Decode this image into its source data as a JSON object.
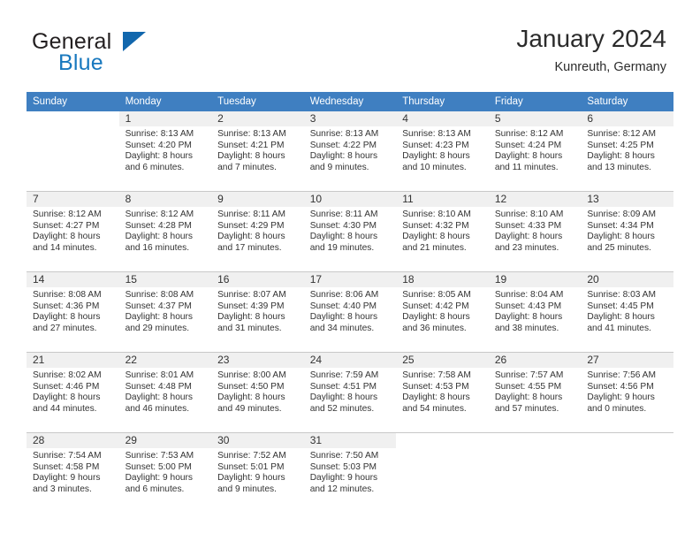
{
  "brand": {
    "name_top": "General",
    "name_bottom": "Blue",
    "mark": "triangle-logo"
  },
  "header": {
    "title": "January 2024",
    "location": "Kunreuth, Germany"
  },
  "calendar": {
    "weekday_headers": [
      "Sunday",
      "Monday",
      "Tuesday",
      "Wednesday",
      "Thursday",
      "Friday",
      "Saturday"
    ],
    "accent_color": "#3f7fc1",
    "daynum_bg": "#f0f0f0",
    "weeks": [
      [
        {
          "day": "",
          "sunrise": "",
          "sunset": "",
          "daylight1": "",
          "daylight2": ""
        },
        {
          "day": "1",
          "sunrise": "Sunrise: 8:13 AM",
          "sunset": "Sunset: 4:20 PM",
          "daylight1": "Daylight: 8 hours",
          "daylight2": "and 6 minutes."
        },
        {
          "day": "2",
          "sunrise": "Sunrise: 8:13 AM",
          "sunset": "Sunset: 4:21 PM",
          "daylight1": "Daylight: 8 hours",
          "daylight2": "and 7 minutes."
        },
        {
          "day": "3",
          "sunrise": "Sunrise: 8:13 AM",
          "sunset": "Sunset: 4:22 PM",
          "daylight1": "Daylight: 8 hours",
          "daylight2": "and 9 minutes."
        },
        {
          "day": "4",
          "sunrise": "Sunrise: 8:13 AM",
          "sunset": "Sunset: 4:23 PM",
          "daylight1": "Daylight: 8 hours",
          "daylight2": "and 10 minutes."
        },
        {
          "day": "5",
          "sunrise": "Sunrise: 8:12 AM",
          "sunset": "Sunset: 4:24 PM",
          "daylight1": "Daylight: 8 hours",
          "daylight2": "and 11 minutes."
        },
        {
          "day": "6",
          "sunrise": "Sunrise: 8:12 AM",
          "sunset": "Sunset: 4:25 PM",
          "daylight1": "Daylight: 8 hours",
          "daylight2": "and 13 minutes."
        }
      ],
      [
        {
          "day": "7",
          "sunrise": "Sunrise: 8:12 AM",
          "sunset": "Sunset: 4:27 PM",
          "daylight1": "Daylight: 8 hours",
          "daylight2": "and 14 minutes."
        },
        {
          "day": "8",
          "sunrise": "Sunrise: 8:12 AM",
          "sunset": "Sunset: 4:28 PM",
          "daylight1": "Daylight: 8 hours",
          "daylight2": "and 16 minutes."
        },
        {
          "day": "9",
          "sunrise": "Sunrise: 8:11 AM",
          "sunset": "Sunset: 4:29 PM",
          "daylight1": "Daylight: 8 hours",
          "daylight2": "and 17 minutes."
        },
        {
          "day": "10",
          "sunrise": "Sunrise: 8:11 AM",
          "sunset": "Sunset: 4:30 PM",
          "daylight1": "Daylight: 8 hours",
          "daylight2": "and 19 minutes."
        },
        {
          "day": "11",
          "sunrise": "Sunrise: 8:10 AM",
          "sunset": "Sunset: 4:32 PM",
          "daylight1": "Daylight: 8 hours",
          "daylight2": "and 21 minutes."
        },
        {
          "day": "12",
          "sunrise": "Sunrise: 8:10 AM",
          "sunset": "Sunset: 4:33 PM",
          "daylight1": "Daylight: 8 hours",
          "daylight2": "and 23 minutes."
        },
        {
          "day": "13",
          "sunrise": "Sunrise: 8:09 AM",
          "sunset": "Sunset: 4:34 PM",
          "daylight1": "Daylight: 8 hours",
          "daylight2": "and 25 minutes."
        }
      ],
      [
        {
          "day": "14",
          "sunrise": "Sunrise: 8:08 AM",
          "sunset": "Sunset: 4:36 PM",
          "daylight1": "Daylight: 8 hours",
          "daylight2": "and 27 minutes."
        },
        {
          "day": "15",
          "sunrise": "Sunrise: 8:08 AM",
          "sunset": "Sunset: 4:37 PM",
          "daylight1": "Daylight: 8 hours",
          "daylight2": "and 29 minutes."
        },
        {
          "day": "16",
          "sunrise": "Sunrise: 8:07 AM",
          "sunset": "Sunset: 4:39 PM",
          "daylight1": "Daylight: 8 hours",
          "daylight2": "and 31 minutes."
        },
        {
          "day": "17",
          "sunrise": "Sunrise: 8:06 AM",
          "sunset": "Sunset: 4:40 PM",
          "daylight1": "Daylight: 8 hours",
          "daylight2": "and 34 minutes."
        },
        {
          "day": "18",
          "sunrise": "Sunrise: 8:05 AM",
          "sunset": "Sunset: 4:42 PM",
          "daylight1": "Daylight: 8 hours",
          "daylight2": "and 36 minutes."
        },
        {
          "day": "19",
          "sunrise": "Sunrise: 8:04 AM",
          "sunset": "Sunset: 4:43 PM",
          "daylight1": "Daylight: 8 hours",
          "daylight2": "and 38 minutes."
        },
        {
          "day": "20",
          "sunrise": "Sunrise: 8:03 AM",
          "sunset": "Sunset: 4:45 PM",
          "daylight1": "Daylight: 8 hours",
          "daylight2": "and 41 minutes."
        }
      ],
      [
        {
          "day": "21",
          "sunrise": "Sunrise: 8:02 AM",
          "sunset": "Sunset: 4:46 PM",
          "daylight1": "Daylight: 8 hours",
          "daylight2": "and 44 minutes."
        },
        {
          "day": "22",
          "sunrise": "Sunrise: 8:01 AM",
          "sunset": "Sunset: 4:48 PM",
          "daylight1": "Daylight: 8 hours",
          "daylight2": "and 46 minutes."
        },
        {
          "day": "23",
          "sunrise": "Sunrise: 8:00 AM",
          "sunset": "Sunset: 4:50 PM",
          "daylight1": "Daylight: 8 hours",
          "daylight2": "and 49 minutes."
        },
        {
          "day": "24",
          "sunrise": "Sunrise: 7:59 AM",
          "sunset": "Sunset: 4:51 PM",
          "daylight1": "Daylight: 8 hours",
          "daylight2": "and 52 minutes."
        },
        {
          "day": "25",
          "sunrise": "Sunrise: 7:58 AM",
          "sunset": "Sunset: 4:53 PM",
          "daylight1": "Daylight: 8 hours",
          "daylight2": "and 54 minutes."
        },
        {
          "day": "26",
          "sunrise": "Sunrise: 7:57 AM",
          "sunset": "Sunset: 4:55 PM",
          "daylight1": "Daylight: 8 hours",
          "daylight2": "and 57 minutes."
        },
        {
          "day": "27",
          "sunrise": "Sunrise: 7:56 AM",
          "sunset": "Sunset: 4:56 PM",
          "daylight1": "Daylight: 9 hours",
          "daylight2": "and 0 minutes."
        }
      ],
      [
        {
          "day": "28",
          "sunrise": "Sunrise: 7:54 AM",
          "sunset": "Sunset: 4:58 PM",
          "daylight1": "Daylight: 9 hours",
          "daylight2": "and 3 minutes."
        },
        {
          "day": "29",
          "sunrise": "Sunrise: 7:53 AM",
          "sunset": "Sunset: 5:00 PM",
          "daylight1": "Daylight: 9 hours",
          "daylight2": "and 6 minutes."
        },
        {
          "day": "30",
          "sunrise": "Sunrise: 7:52 AM",
          "sunset": "Sunset: 5:01 PM",
          "daylight1": "Daylight: 9 hours",
          "daylight2": "and 9 minutes."
        },
        {
          "day": "31",
          "sunrise": "Sunrise: 7:50 AM",
          "sunset": "Sunset: 5:03 PM",
          "daylight1": "Daylight: 9 hours",
          "daylight2": "and 12 minutes."
        },
        {
          "day": "",
          "sunrise": "",
          "sunset": "",
          "daylight1": "",
          "daylight2": ""
        },
        {
          "day": "",
          "sunrise": "",
          "sunset": "",
          "daylight1": "",
          "daylight2": ""
        },
        {
          "day": "",
          "sunrise": "",
          "sunset": "",
          "daylight1": "",
          "daylight2": ""
        }
      ]
    ]
  }
}
